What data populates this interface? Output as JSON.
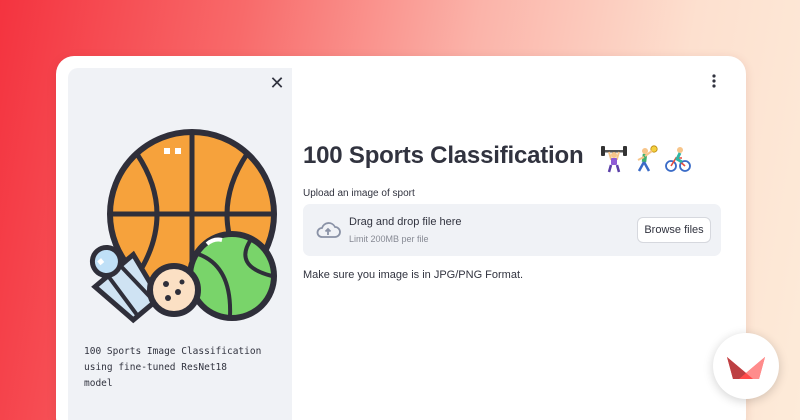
{
  "sidebar": {
    "close_glyph": "✕",
    "description": "100 Sports Image Classification\nusing fine-tuned ResNet18\nmodel"
  },
  "main": {
    "title": "100 Sports Classification",
    "title_emojis": [
      "weightlifting-icon",
      "handball-icon",
      "cycling-icon"
    ],
    "menu_icon": "kebab-menu-icon",
    "uploader": {
      "label": "Upload an image of sport",
      "drop_text": "Drag and drop file here",
      "limit_text": "Limit 200MB per file",
      "browse_label": "Browse files",
      "icon": "cloud-upload-icon"
    },
    "note": "Make sure you image is in JPG/PNG Format."
  },
  "branding": {
    "logo": "streamlit-logo",
    "accent": "#ff4b4b"
  },
  "colors": {
    "sidebar_bg": "#f0f2f6",
    "text": "#31333f",
    "muted": "#878a94",
    "basketball": "#f6a23c",
    "tennis_ball": "#79d46a",
    "outline": "#2f2f3a"
  }
}
